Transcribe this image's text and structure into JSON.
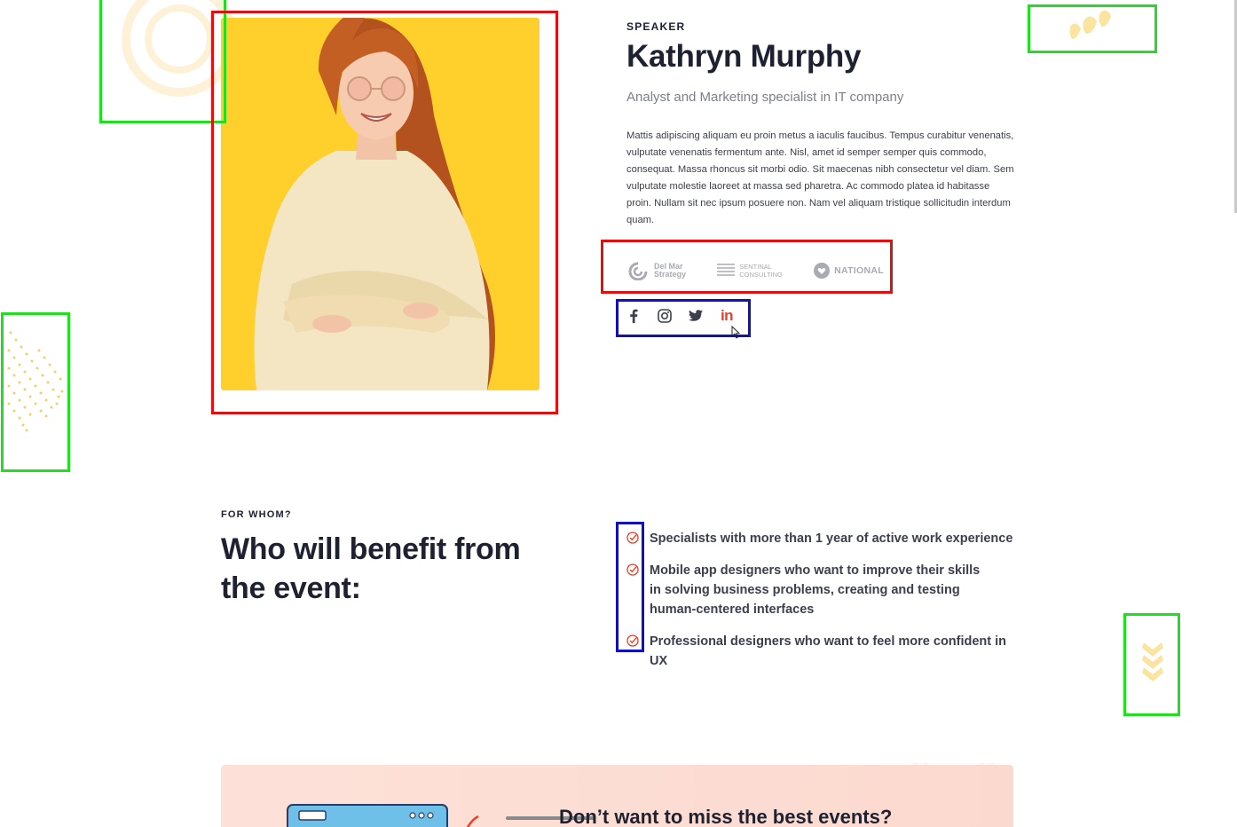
{
  "speaker": {
    "eyebrow": "SPEAKER",
    "name": "Kathryn Murphy",
    "role": "Analyst and Marketing specialist in IT company",
    "bio": "Mattis adipiscing aliquam eu proin metus a iaculis faucibus. Tempus curabitur venenatis, vulputate venenatis fermentum ante. Nisl, amet id semper semper quis commodo, consequat. Massa rhoncus sit morbi odio. Sit maecenas nibh consectetur vel diam. Sem vulputate molestie laoreet at massa sed pharetra. Ac commodo platea id habitasse proin. Nullam sit nec ipsum posuere non. Nam vel aliquam tristique sollicitudin interdum quam.",
    "logos": [
      {
        "line1": "Del Mar",
        "line2": "Strategy",
        "icon": "swirl-logo-icon"
      },
      {
        "line1": "SENTINAL",
        "line2": "CONSULTING",
        "icon": "stripes-logo-icon"
      },
      {
        "label": "NATIONAL",
        "icon": "heart-logo-icon"
      }
    ],
    "socials": [
      {
        "name": "facebook",
        "icon": "facebook-icon",
        "color": "#3c404c"
      },
      {
        "name": "instagram",
        "icon": "instagram-icon",
        "color": "#3c404c"
      },
      {
        "name": "twitter",
        "icon": "twitter-icon",
        "color": "#3c404c"
      },
      {
        "name": "linkedin",
        "icon": "linkedin-icon",
        "color": "#e8412c",
        "label": "in"
      }
    ]
  },
  "for_whom": {
    "eyebrow": "FOR WHOM?",
    "title": "Who will benefit from the event:",
    "items": [
      "Specialists with more than 1 year of active work experience",
      "Mobile app designers who want to improve their skills in solving business problems, creating and testing human-centered interfaces",
      "Professional designers who want to feel more confident in UX"
    ]
  },
  "newsletter": {
    "title": "Don’t want to miss the best events?"
  },
  "colors": {
    "photo_bg": "#ffd02b",
    "accent_red": "#e8412c",
    "text_dark": "#1d2130",
    "annotation_green": "#22dd22",
    "annotation_red": "#dd1111",
    "annotation_blue": "#1111bb",
    "decor_yellow": "#fbe3a0"
  }
}
